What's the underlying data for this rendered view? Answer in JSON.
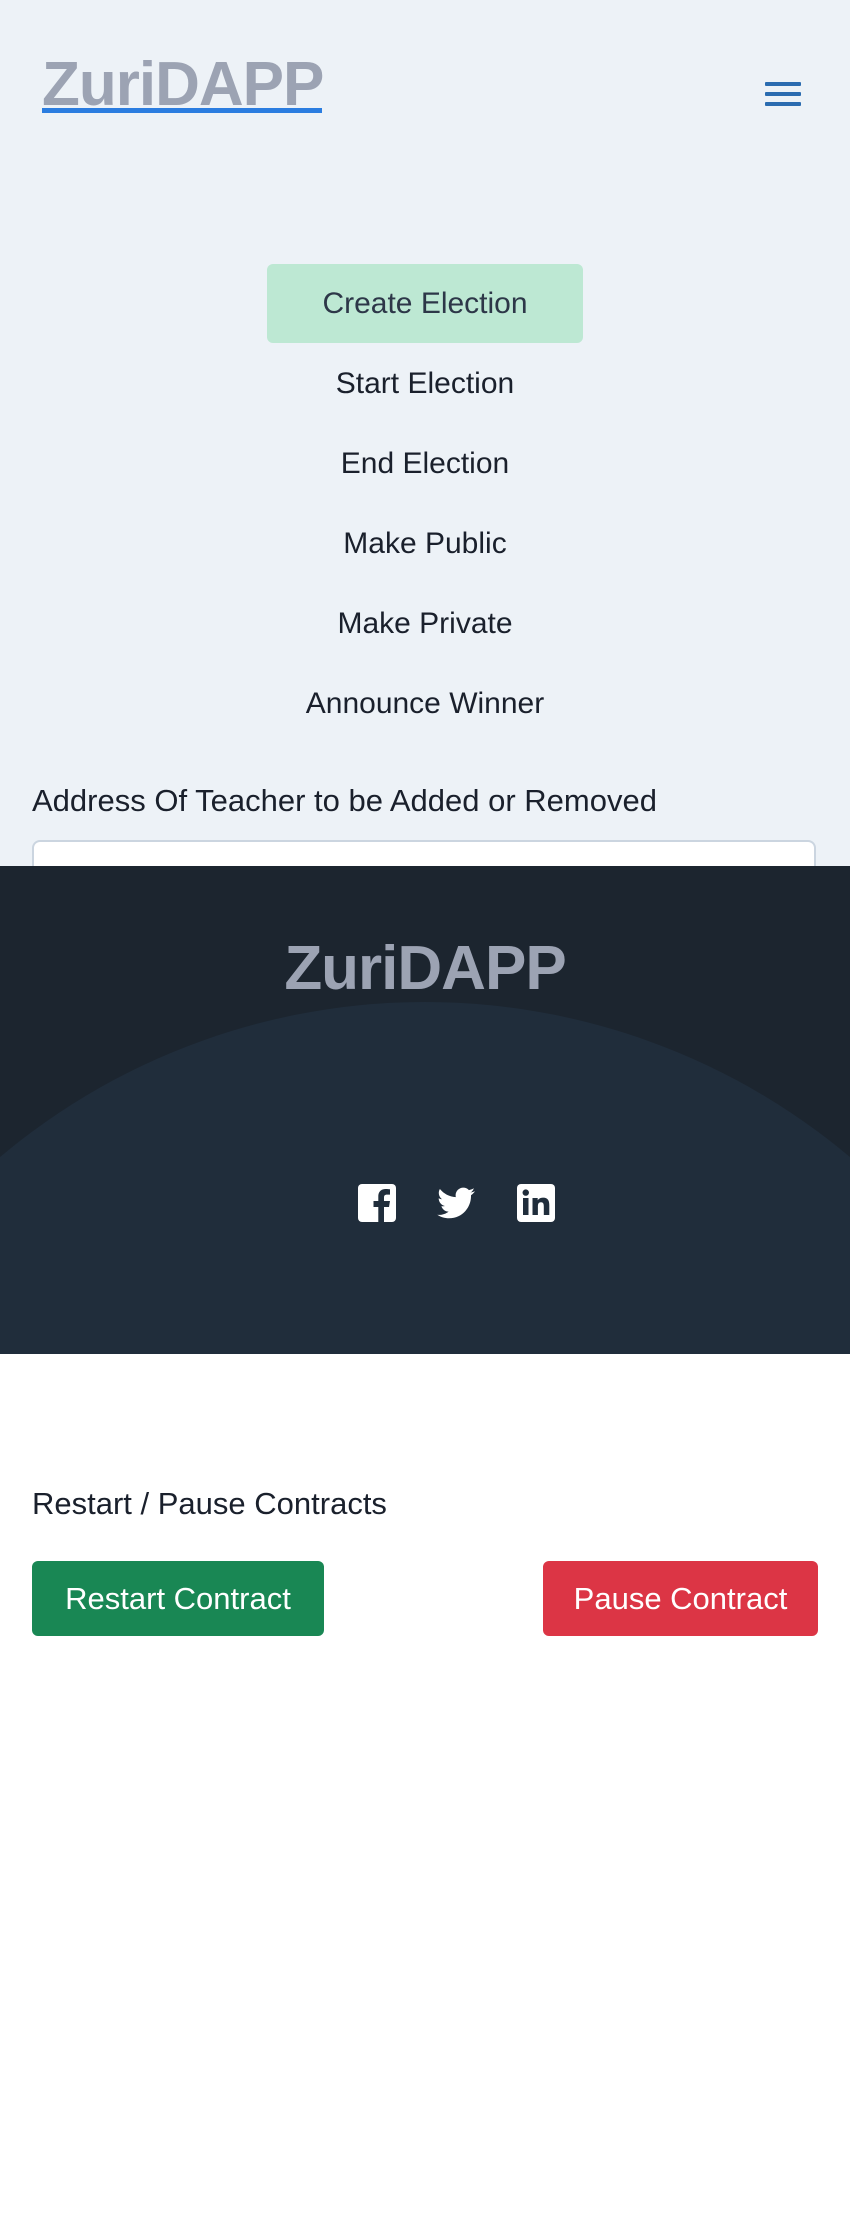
{
  "header": {
    "logo": "ZuriDAPP",
    "menu_icon": "hamburger-menu-icon"
  },
  "nav": {
    "items": [
      {
        "label": "Create Election",
        "active": true
      },
      {
        "label": "Start Election",
        "active": false
      },
      {
        "label": "End Election",
        "active": false
      },
      {
        "label": "Make Public",
        "active": false
      },
      {
        "label": "Make Private",
        "active": false
      },
      {
        "label": "Announce Winner",
        "active": false
      }
    ]
  },
  "teacher_form": {
    "label": "Address Of Teacher to be Added or Removed",
    "value": "",
    "placeholder": ""
  },
  "footer": {
    "logo": "ZuriDAPP",
    "social": [
      "facebook-icon",
      "twitter-icon",
      "linkedin-icon"
    ]
  },
  "contracts": {
    "label": "Restart / Pause Contracts",
    "restart_label": "Restart Contract",
    "pause_label": "Pause Contract"
  },
  "colors": {
    "accent": "#2b7de0",
    "active_nav_bg": "#bde8d3",
    "footer_bg": "#1c252f",
    "success": "#198754",
    "danger": "#dc3545"
  }
}
